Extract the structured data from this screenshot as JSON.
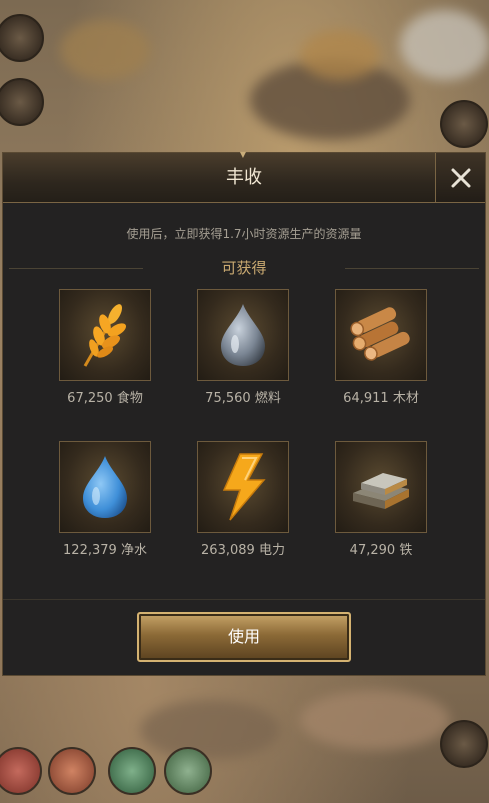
{
  "dialog": {
    "title": "丰收",
    "description": "使用后，立即获得1.7小时资源生产的资源量",
    "subheader": "可获得",
    "use_button": "使用"
  },
  "rewards": [
    {
      "amount": "67,250",
      "name": "食物",
      "icon": "wheat-icon",
      "color": "#f2a52a"
    },
    {
      "amount": "75,560",
      "name": "燃料",
      "icon": "oil-drop-icon",
      "color": "#8a97a6"
    },
    {
      "amount": "64,911",
      "name": "木材",
      "icon": "wood-logs-icon",
      "color": "#c98847"
    },
    {
      "amount": "122,379",
      "name": "净水",
      "icon": "water-drop-icon",
      "color": "#3f8fd8"
    },
    {
      "amount": "263,089",
      "name": "电力",
      "icon": "lightning-icon",
      "color": "#f6a81b"
    },
    {
      "amount": "47,290",
      "name": "铁",
      "icon": "iron-ingot-icon",
      "color": "#9a9a92"
    }
  ]
}
